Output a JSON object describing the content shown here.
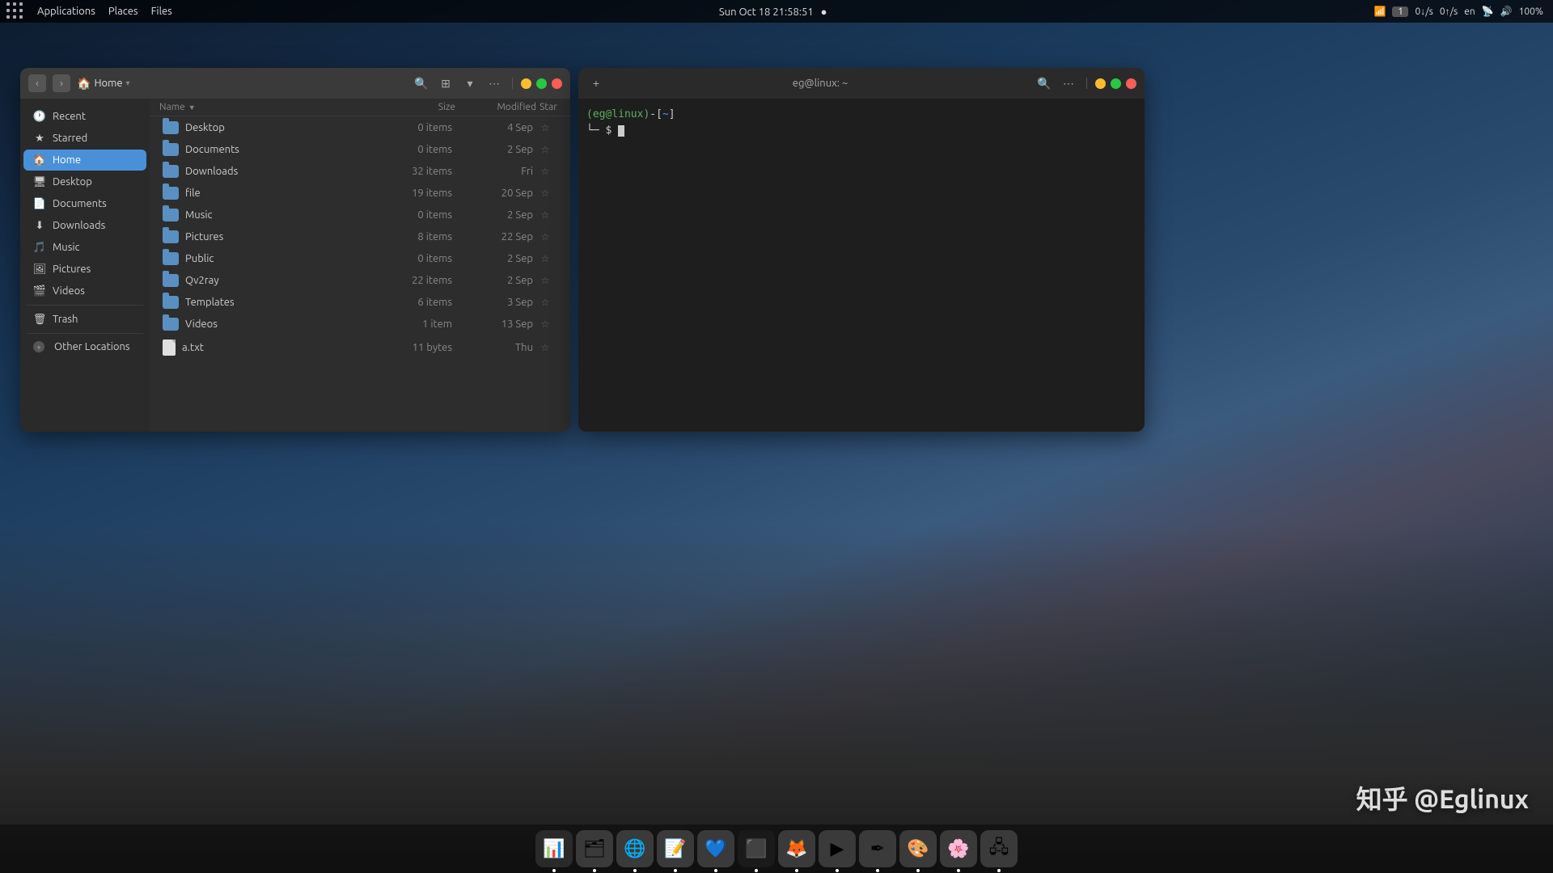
{
  "topbar": {
    "datetime": "Sun Oct 18  21:58:51",
    "indicator": "●",
    "badge_num": "1",
    "download_speed": "0↓/s",
    "upload_speed": "0↑/s",
    "lang": "en",
    "battery": "100%"
  },
  "file_manager": {
    "title": "Home",
    "location": "Home",
    "columns": {
      "name": "Name",
      "size": "Size",
      "modified": "Modified",
      "star": "Star"
    },
    "files": [
      {
        "name": "Desktop",
        "type": "folder",
        "size": "0 items",
        "modified": "4 Sep"
      },
      {
        "name": "Documents",
        "type": "folder",
        "size": "0 items",
        "modified": "2 Sep"
      },
      {
        "name": "Downloads",
        "type": "folder",
        "size": "32 items",
        "modified": "Fri"
      },
      {
        "name": "file",
        "type": "folder",
        "size": "19 items",
        "modified": "20 Sep"
      },
      {
        "name": "Music",
        "type": "folder",
        "size": "0 items",
        "modified": "2 Sep"
      },
      {
        "name": "Pictures",
        "type": "folder",
        "size": "8 items",
        "modified": "22 Sep"
      },
      {
        "name": "Public",
        "type": "folder",
        "size": "0 items",
        "modified": "2 Sep"
      },
      {
        "name": "Qv2ray",
        "type": "folder",
        "size": "22 items",
        "modified": "2 Sep"
      },
      {
        "name": "Templates",
        "type": "folder",
        "size": "6 items",
        "modified": "3 Sep"
      },
      {
        "name": "Videos",
        "type": "folder",
        "size": "1 item",
        "modified": "13 Sep"
      },
      {
        "name": "a.txt",
        "type": "file",
        "size": "11 bytes",
        "modified": "Thu"
      }
    ],
    "sidebar": {
      "items": [
        {
          "label": "Recent",
          "icon": "🕐",
          "active": false
        },
        {
          "label": "Starred",
          "icon": "★",
          "active": false
        },
        {
          "label": "Home",
          "icon": "🏠",
          "active": true
        },
        {
          "label": "Desktop",
          "icon": "🖥",
          "active": false
        },
        {
          "label": "Documents",
          "icon": "📄",
          "active": false
        },
        {
          "label": "Downloads",
          "icon": "⬇",
          "active": false
        },
        {
          "label": "Music",
          "icon": "🎵",
          "active": false
        },
        {
          "label": "Pictures",
          "icon": "🖼",
          "active": false
        },
        {
          "label": "Videos",
          "icon": "🎬",
          "active": false
        },
        {
          "label": "Trash",
          "icon": "🗑",
          "active": false
        },
        {
          "label": "Other Locations",
          "icon": "+",
          "active": false
        }
      ]
    }
  },
  "terminal": {
    "title": "eg@linux: ~",
    "prompt_user": "(eg@linux)",
    "prompt_bracket_open": "-[",
    "prompt_dir": "~",
    "prompt_bracket_close": "]",
    "prompt_symbol": "$"
  },
  "watermark": "知乎 @Eglinux",
  "dock": {
    "items": [
      {
        "label": "System Monitor",
        "icon": "📊",
        "color": "#2a2a2a"
      },
      {
        "label": "Files",
        "icon": "🗂",
        "color": "#3a3a3a"
      },
      {
        "label": "Chrome",
        "icon": "🌐",
        "color": "#3a3a3a"
      },
      {
        "label": "Text Editor",
        "icon": "📝",
        "color": "#3a3a3a"
      },
      {
        "label": "VS Code",
        "icon": "💙",
        "color": "#3a3a3a"
      },
      {
        "label": "Terminal",
        "icon": "⬛",
        "color": "#1a1a1a"
      },
      {
        "label": "Mascot",
        "icon": "🦊",
        "color": "#3a3a3a"
      },
      {
        "label": "Media",
        "icon": "▶",
        "color": "#3a3a3a"
      },
      {
        "label": "Pen",
        "icon": "✒",
        "color": "#3a3a3a"
      },
      {
        "label": "Color",
        "icon": "🎨",
        "color": "#3a3a3a"
      },
      {
        "label": "Pink App",
        "icon": "🌸",
        "color": "#3a3a3a"
      },
      {
        "label": "VM",
        "icon": "🖧",
        "color": "#3a3a3a"
      }
    ]
  }
}
